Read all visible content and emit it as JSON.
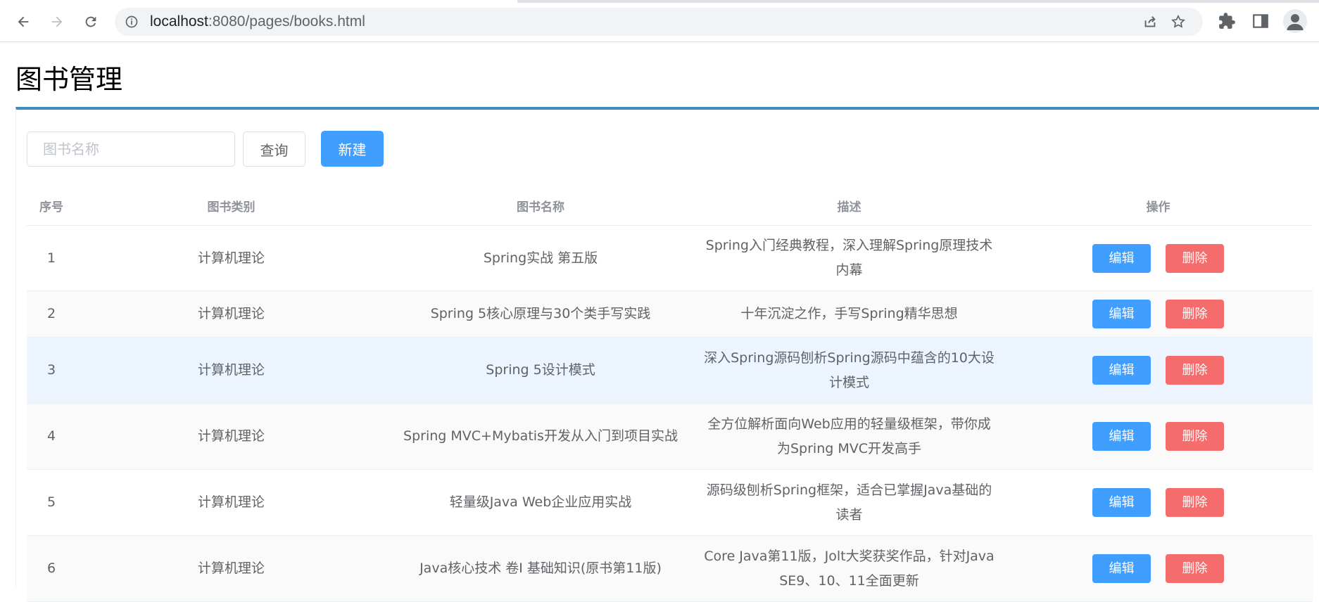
{
  "browser": {
    "url_host": "localhost",
    "url_rest": ":8080/pages/books.html"
  },
  "page": {
    "title": "图书管理"
  },
  "toolbar": {
    "search_placeholder": "图书名称",
    "search_value": "",
    "query_label": "查询",
    "new_label": "新建"
  },
  "table": {
    "columns": [
      "序号",
      "图书类别",
      "图书名称",
      "描述",
      "操作"
    ],
    "edit_label": "编辑",
    "delete_label": "删除",
    "rows": [
      {
        "index": "1",
        "type": "计算机理论",
        "name": "Spring实战 第五版",
        "description": "Spring入门经典教程，深入理解Spring原理技术内幕"
      },
      {
        "index": "2",
        "type": "计算机理论",
        "name": "Spring 5核心原理与30个类手写实践",
        "description": "十年沉淀之作，手写Spring精华思想"
      },
      {
        "index": "3",
        "type": "计算机理论",
        "name": "Spring 5设计模式",
        "description": "深入Spring源码刨析Spring源码中蕴含的10大设计模式"
      },
      {
        "index": "4",
        "type": "计算机理论",
        "name": "Spring MVC+Mybatis开发从入门到项目实战",
        "description": "全方位解析面向Web应用的轻量级框架，带你成为Spring MVC开发高手"
      },
      {
        "index": "5",
        "type": "计算机理论",
        "name": "轻量级Java Web企业应用实战",
        "description": "源码级刨析Spring框架，适合已掌握Java基础的读者"
      },
      {
        "index": "6",
        "type": "计算机理论",
        "name": "Java核心技术 卷Ⅰ 基础知识(原书第11版)",
        "description": "Core Java第11版，Jolt大奖获奖作品，针对Java SE9、10、11全面更新"
      }
    ]
  },
  "colors": {
    "primary": "#409eff",
    "danger": "#f56c6c",
    "header_border": "#3c8dbc"
  }
}
